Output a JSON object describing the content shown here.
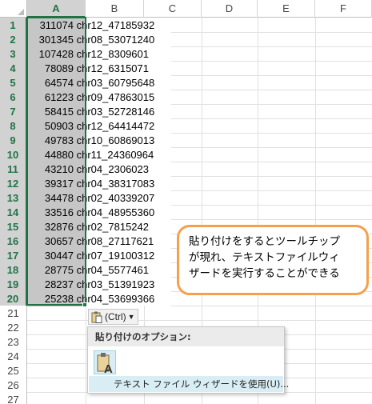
{
  "columns": [
    "A",
    "B",
    "C",
    "D",
    "E",
    "F"
  ],
  "rows": [
    {
      "n": "1",
      "num": "311074",
      "chr": "chr12_47185932"
    },
    {
      "n": "2",
      "num": "301345",
      "chr": "chr08_53071240"
    },
    {
      "n": "3",
      "num": "107428",
      "chr": "chr12_8309601"
    },
    {
      "n": "4",
      "num": "78089",
      "chr": "chr12_6315071"
    },
    {
      "n": "5",
      "num": "64574",
      "chr": "chr03_60795648"
    },
    {
      "n": "6",
      "num": "61223",
      "chr": "chr09_47863015"
    },
    {
      "n": "7",
      "num": "58415",
      "chr": "chr03_52728146"
    },
    {
      "n": "8",
      "num": "50903",
      "chr": "chr12_64414472"
    },
    {
      "n": "9",
      "num": "49783",
      "chr": "chr10_60869013"
    },
    {
      "n": "10",
      "num": "44880",
      "chr": "chr11_24360964"
    },
    {
      "n": "11",
      "num": "43210",
      "chr": "chr04_2306023"
    },
    {
      "n": "12",
      "num": "39317",
      "chr": "chr04_38317083"
    },
    {
      "n": "13",
      "num": "34478",
      "chr": "chr02_40339207"
    },
    {
      "n": "14",
      "num": "33516",
      "chr": "chr04_48955360"
    },
    {
      "n": "15",
      "num": "32876",
      "chr": "chr02_7815242"
    },
    {
      "n": "16",
      "num": "30657",
      "chr": "chr08_27117621"
    },
    {
      "n": "17",
      "num": "30447",
      "chr": "chr07_19100312"
    },
    {
      "n": "18",
      "num": "28775",
      "chr": "chr04_5577461"
    },
    {
      "n": "19",
      "num": "28237",
      "chr": "chr03_51391923"
    },
    {
      "n": "20",
      "num": "25238",
      "chr": "chr04_53699366"
    }
  ],
  "empty_rows": [
    "21",
    "22",
    "23",
    "24",
    "25",
    "26",
    "27"
  ],
  "callout": {
    "line1": "貼り付けをするとツールチップ",
    "line2": "が現れ、テキストファイルウィ",
    "line3": "ザードを実行することができる"
  },
  "paste_options": {
    "button_label": "(Ctrl)",
    "menu_title": "貼り付けのオプション:",
    "wizard_label": "テキスト ファイル ウィザードを使用(U)..."
  },
  "icons": {
    "paste": "clipboard-paste-icon",
    "text_wizard": "text-import-icon",
    "dropdown": "chevron-down-icon"
  },
  "colors": {
    "excel_green": "#217346",
    "selection_fill": "#c6c6c6",
    "callout_border": "#f6a04d",
    "menu_highlight": "#d9eef4"
  }
}
